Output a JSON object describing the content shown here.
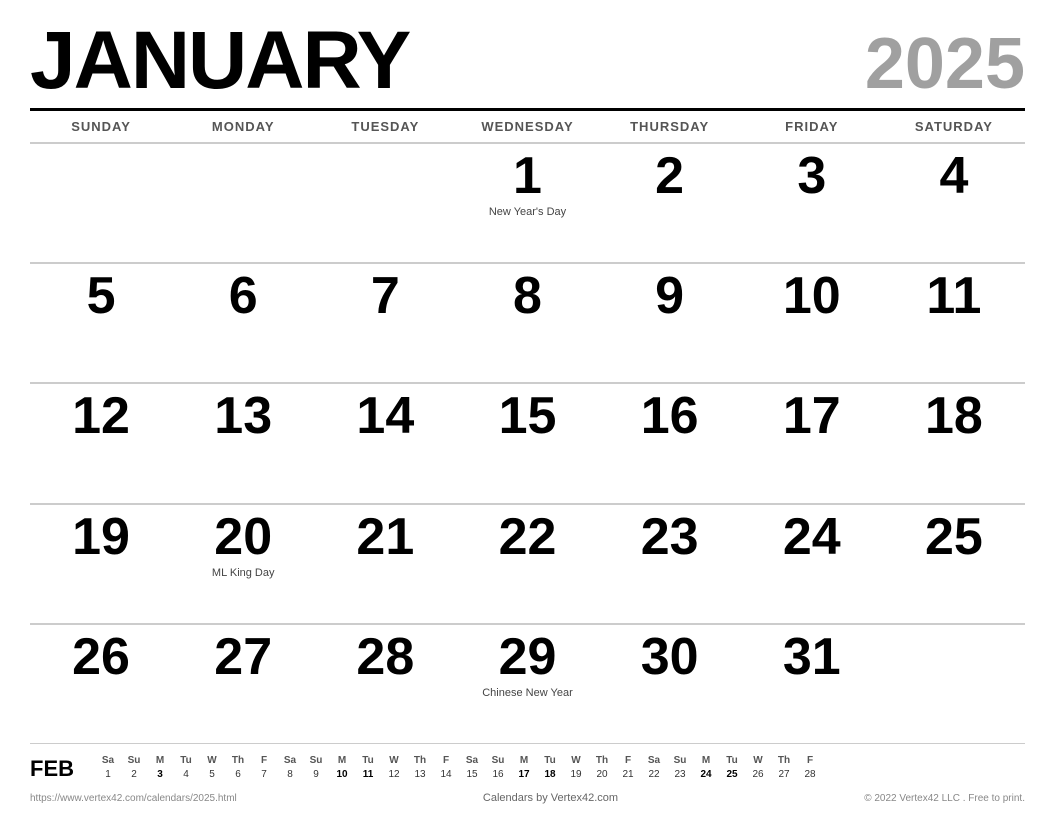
{
  "header": {
    "month": "JANUARY",
    "year": "2025"
  },
  "day_headers": [
    "SUNDAY",
    "MONDAY",
    "TUESDAY",
    "WEDNESDAY",
    "THURSDAY",
    "FRIDAY",
    "SATURDAY"
  ],
  "weeks": [
    [
      {
        "day": "",
        "holiday": ""
      },
      {
        "day": "",
        "holiday": ""
      },
      {
        "day": "",
        "holiday": ""
      },
      {
        "day": "1",
        "holiday": "New Year's Day"
      },
      {
        "day": "2",
        "holiday": ""
      },
      {
        "day": "3",
        "holiday": ""
      },
      {
        "day": "4",
        "holiday": ""
      }
    ],
    [
      {
        "day": "5",
        "holiday": ""
      },
      {
        "day": "6",
        "holiday": ""
      },
      {
        "day": "7",
        "holiday": ""
      },
      {
        "day": "8",
        "holiday": ""
      },
      {
        "day": "9",
        "holiday": ""
      },
      {
        "day": "10",
        "holiday": ""
      },
      {
        "day": "11",
        "holiday": ""
      }
    ],
    [
      {
        "day": "12",
        "holiday": ""
      },
      {
        "day": "13",
        "holiday": ""
      },
      {
        "day": "14",
        "holiday": ""
      },
      {
        "day": "15",
        "holiday": ""
      },
      {
        "day": "16",
        "holiday": ""
      },
      {
        "day": "17",
        "holiday": ""
      },
      {
        "day": "18",
        "holiday": ""
      }
    ],
    [
      {
        "day": "19",
        "holiday": ""
      },
      {
        "day": "20",
        "holiday": "ML King Day"
      },
      {
        "day": "21",
        "holiday": ""
      },
      {
        "day": "22",
        "holiday": ""
      },
      {
        "day": "23",
        "holiday": ""
      },
      {
        "day": "24",
        "holiday": ""
      },
      {
        "day": "25",
        "holiday": ""
      }
    ],
    [
      {
        "day": "26",
        "holiday": ""
      },
      {
        "day": "27",
        "holiday": ""
      },
      {
        "day": "28",
        "holiday": ""
      },
      {
        "day": "29",
        "holiday": "Chinese New Year"
      },
      {
        "day": "30",
        "holiday": ""
      },
      {
        "day": "31",
        "holiday": ""
      },
      {
        "day": "",
        "holiday": ""
      }
    ]
  ],
  "mini_calendar": {
    "month_label": "FEB",
    "headers": [
      "Sa",
      "Su",
      "M",
      "Tu",
      "W",
      "Th",
      "F",
      "Sa",
      "Su",
      "M",
      "Tu",
      "W",
      "Th",
      "F",
      "Sa",
      "Su",
      "M",
      "Tu",
      "W",
      "Th",
      "F",
      "Sa",
      "Su",
      "M",
      "Tu",
      "W",
      "Th",
      "F"
    ],
    "days": [
      "1",
      "2",
      "3",
      "4",
      "5",
      "6",
      "7",
      "8",
      "9",
      "10",
      "11",
      "12",
      "13",
      "14",
      "15",
      "16",
      "17",
      "18",
      "19",
      "20",
      "21",
      "22",
      "23",
      "24",
      "25",
      "26",
      "27",
      "28"
    ],
    "bold_days": [
      "3",
      "10",
      "11",
      "17",
      "18",
      "24",
      "25"
    ]
  },
  "footer": {
    "left": "https://www.vertex42.com/calendars/2025.html",
    "center": "Calendars by Vertex42.com",
    "right": "© 2022 Vertex42 LLC . Free to print."
  }
}
